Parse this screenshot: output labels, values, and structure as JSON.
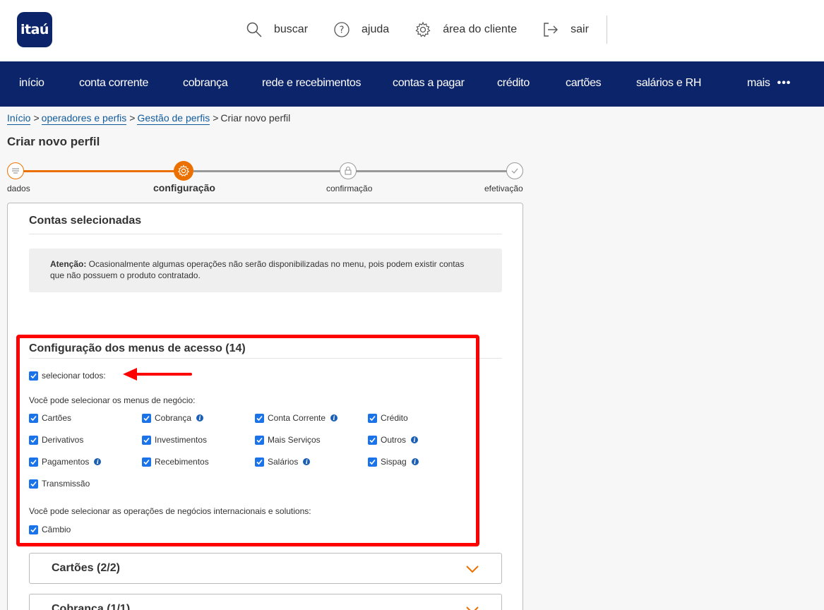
{
  "header": {
    "logo_text": "itaú",
    "links": [
      {
        "label": "buscar",
        "icon": "search-icon"
      },
      {
        "label": "ajuda",
        "icon": "help-icon"
      },
      {
        "label": "área do cliente",
        "icon": "gear-icon"
      },
      {
        "label": "sair",
        "icon": "logout-icon"
      }
    ]
  },
  "nav": {
    "items": [
      "início",
      "conta corrente",
      "cobrança",
      "rede e recebimentos",
      "contas a pagar",
      "crédito",
      "cartões",
      "salários e RH",
      "mais"
    ]
  },
  "breadcrumb": {
    "items": [
      "Início",
      "operadores e perfis",
      "Gestão de perfis"
    ],
    "current": "Criar novo perfil"
  },
  "page": {
    "title": "Criar novo perfil"
  },
  "stepper": {
    "steps": [
      {
        "label": "dados",
        "state": "done"
      },
      {
        "label": "configuração",
        "state": "active"
      },
      {
        "label": "confirmação",
        "state": "pending"
      },
      {
        "label": "efetivação",
        "state": "pending"
      }
    ],
    "colors": {
      "active": "#ec7000",
      "pending": "#999999"
    }
  },
  "accounts": {
    "title": "Contas selecionadas",
    "alert_strong": "Atenção:",
    "alert_text": " Ocasionalmente algumas operações não serão disponibilizadas no menu, pois podem existir contas",
    "alert_text2": "que não possuem o produto contratado."
  },
  "access": {
    "title": "Configuração dos menus de acesso (14)",
    "select_all": "selecionar todos:",
    "business_helper": "Você pode selecionar os menus de negócio:",
    "business_menus": [
      {
        "label": "Cartões",
        "info": false
      },
      {
        "label": "Cobrança",
        "info": true
      },
      {
        "label": "Conta Corrente",
        "info": true
      },
      {
        "label": "Crédito",
        "info": false
      },
      {
        "label": "Derivativos",
        "info": false
      },
      {
        "label": "Investimentos",
        "info": false
      },
      {
        "label": "Mais Serviços",
        "info": false
      },
      {
        "label": "Outros",
        "info": true
      },
      {
        "label": "Pagamentos",
        "info": true
      },
      {
        "label": "Recebimentos",
        "info": false
      },
      {
        "label": "Salários",
        "info": true
      },
      {
        "label": "Sispag",
        "info": true
      },
      {
        "label": "Transmissão",
        "info": false
      }
    ],
    "intl_helper": "Você pode selecionar as operações de negócios internacionais e solutions:",
    "intl_menus": [
      {
        "label": "Câmbio",
        "info": false
      }
    ]
  },
  "accordions": [
    {
      "title": "Cartões (2/2)"
    },
    {
      "title": "Cobrança (1/1)"
    }
  ],
  "colors": {
    "brand": "#0c2469",
    "accent": "#ec7000",
    "checkbox": "#1a73e8",
    "annotation": "#ff0000"
  }
}
